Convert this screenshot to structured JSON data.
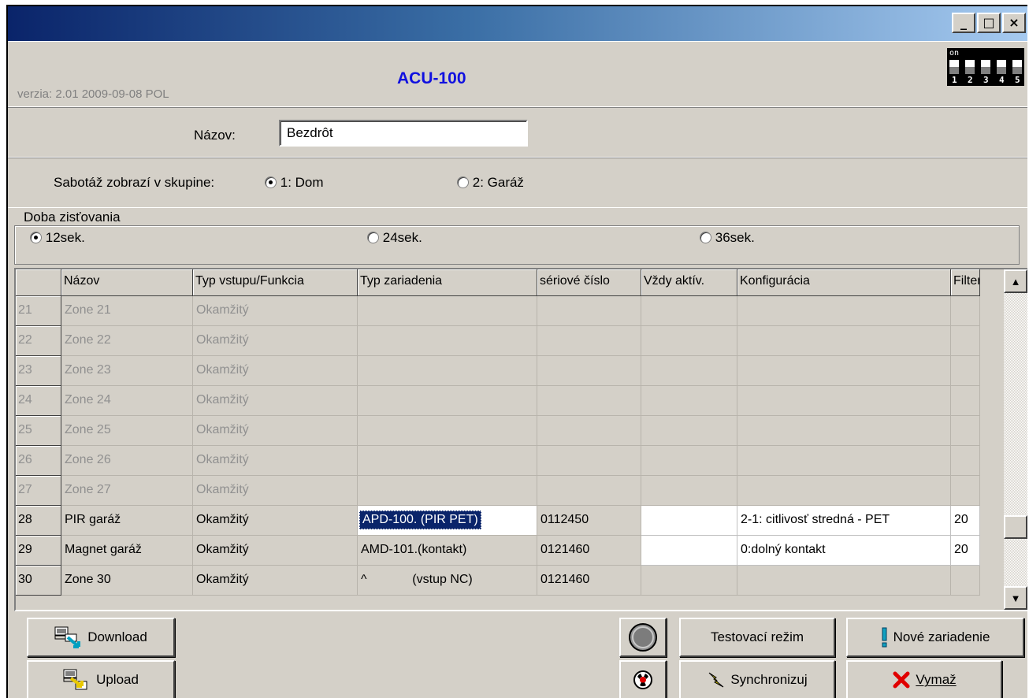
{
  "window": {
    "minimize_glyph": "_",
    "maximize_glyph": "□",
    "close_glyph": "×"
  },
  "header": {
    "version": "verzia: 2.01 2009-09-08 POL",
    "title": "ACU-100",
    "dip_on_label": "on",
    "dip_numbers": [
      "1",
      "2",
      "3",
      "4",
      "5"
    ]
  },
  "name_field": {
    "label": "Názov:",
    "value": "Bezdrôt"
  },
  "tamper": {
    "label": "Sabotáž zobrazí v skupine:",
    "options": [
      "1: Dom",
      "2: Garáž"
    ],
    "selected": "1: Dom"
  },
  "detection": {
    "label": "Doba zisťovania",
    "options": [
      "12sek.",
      "24sek.",
      "36sek."
    ],
    "selected": "12sek."
  },
  "grid": {
    "columns": [
      "Názov",
      "Typ vstupu/Funkcia",
      "Typ zariadenia",
      "sériové číslo",
      "Vždy aktív.",
      "Konfigurácia",
      "Filter"
    ],
    "rows": [
      {
        "no": "21",
        "name": "Zone 21",
        "type": "Okamžitý",
        "device": "",
        "serial": "",
        "always": "",
        "config": "",
        "filter": "",
        "enabled": false
      },
      {
        "no": "22",
        "name": "Zone 22",
        "type": "Okamžitý",
        "device": "",
        "serial": "",
        "always": "",
        "config": "",
        "filter": "",
        "enabled": false
      },
      {
        "no": "23",
        "name": "Zone 23",
        "type": "Okamžitý",
        "device": "",
        "serial": "",
        "always": "",
        "config": "",
        "filter": "",
        "enabled": false
      },
      {
        "no": "24",
        "name": "Zone 24",
        "type": "Okamžitý",
        "device": "",
        "serial": "",
        "always": "",
        "config": "",
        "filter": "",
        "enabled": false
      },
      {
        "no": "25",
        "name": "Zone 25",
        "type": "Okamžitý",
        "device": "",
        "serial": "",
        "always": "",
        "config": "",
        "filter": "",
        "enabled": false
      },
      {
        "no": "26",
        "name": "Zone 26",
        "type": "Okamžitý",
        "device": "",
        "serial": "",
        "always": "",
        "config": "",
        "filter": "",
        "enabled": false
      },
      {
        "no": "27",
        "name": "Zone 27",
        "type": "Okamžitý",
        "device": "",
        "serial": "",
        "always": "",
        "config": "",
        "filter": "",
        "enabled": false
      },
      {
        "no": "28",
        "name": "PIR garáž",
        "type": "Okamžitý",
        "device": "APD-100. (PIR PET)",
        "serial": "0112450",
        "always": "",
        "config": "2-1: citlivosť stredná - PET",
        "filter": "20",
        "enabled": true,
        "selected_device": true
      },
      {
        "no": "29",
        "name": "Magnet garáž",
        "type": "Okamžitý",
        "device": "AMD-101.(kontakt)",
        "serial": "0121460",
        "always": "",
        "config": "0:dolný kontakt",
        "filter": "20",
        "enabled": true
      },
      {
        "no": "30",
        "name": "Zone 30",
        "type": "Okamžitý",
        "device": "^             (vstup NC)",
        "serial": "0121460",
        "always": "",
        "config": "",
        "filter": "",
        "enabled": true,
        "partial": true
      }
    ]
  },
  "buttons": {
    "download": "Download",
    "upload": "Upload",
    "test_mode": "Testovací režim",
    "new_device": "Nové zariadenie",
    "synchronize": "Synchronizuj",
    "delete": "Vymaž"
  },
  "colors": {
    "title_blue": "#1010e0",
    "selection": "#0a246a",
    "face": "#d4d0c8"
  }
}
